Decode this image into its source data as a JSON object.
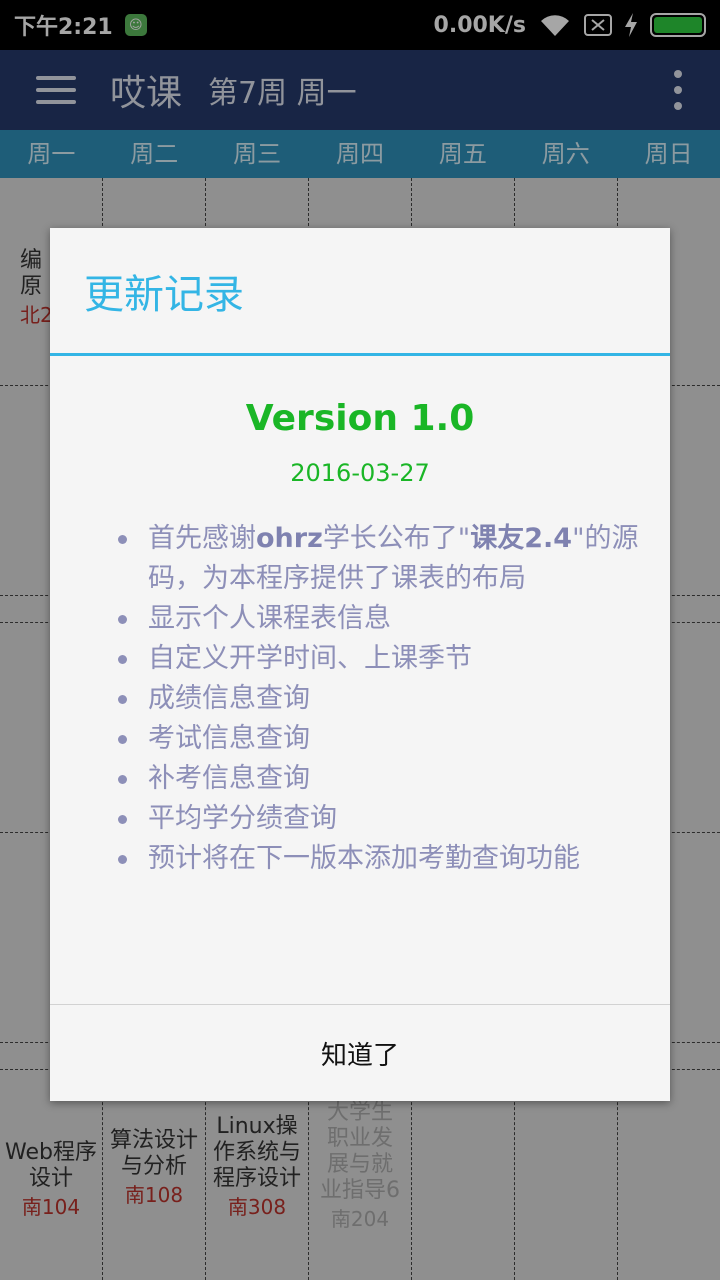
{
  "status_bar": {
    "time": "下午2:21",
    "net_speed": "0.00K/s",
    "battery_level": 1.0
  },
  "app_bar": {
    "title": "哎课",
    "subtitle": "第7周 周一"
  },
  "week_days": [
    "周一",
    "周二",
    "周三",
    "周四",
    "周五",
    "周六",
    "周日"
  ],
  "timetable": {
    "partial_course": {
      "line1": "编",
      "line2": "原",
      "room": "北2"
    },
    "courses": [
      {
        "name": "Web程序设计",
        "room": "南104"
      },
      {
        "name": "算法设计与分析",
        "room": "南108"
      },
      {
        "name": "Linux操作系统与程序设计",
        "room": "南308"
      },
      {
        "name": "大学生职业发展与就业指导6",
        "room": "南204"
      }
    ]
  },
  "dialog": {
    "title": "更新记录",
    "version": "Version 1.0",
    "date": "2016-03-27",
    "items": {
      "item1_pre": "首先感谢",
      "item1_bold1": "ohrz",
      "item1_mid": "学长公布了\"",
      "item1_bold2": "课友2.4",
      "item1_post": "\"的源码，为本程序提供了课表的布局",
      "item2": "显示个人课程表信息",
      "item3": "自定义开学时间、上课季节",
      "item4": "成绩信息查询",
      "item5": "考试信息查询",
      "item6": "补考信息查询",
      "item7": "平均学分绩查询",
      "item8": "预计将在下一版本添加考勤查询功能"
    },
    "confirm_button": "知道了"
  }
}
